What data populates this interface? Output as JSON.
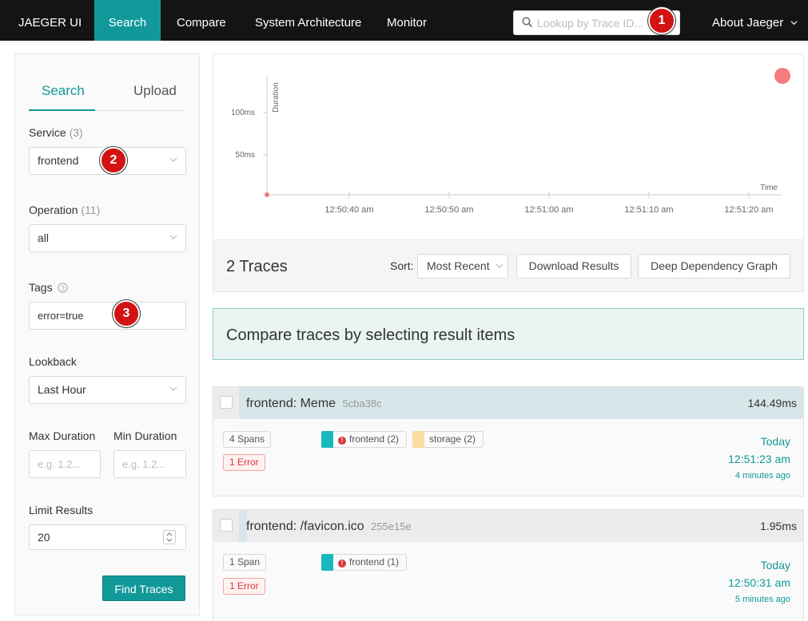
{
  "nav": {
    "brand": "JAEGER UI",
    "items": [
      "Search",
      "Compare",
      "System Architecture",
      "Monitor"
    ],
    "lookup_placeholder": "Lookup by Trace ID...",
    "about": "About Jaeger"
  },
  "badges": [
    "1",
    "2",
    "3"
  ],
  "form": {
    "tabs": [
      "Search",
      "Upload"
    ],
    "service_label": "Service",
    "service_count": "(3)",
    "service_value": "frontend",
    "operation_label": "Operation",
    "operation_count": "(11)",
    "operation_value": "all",
    "tags_label": "Tags",
    "tags_value": "error=true",
    "lookback_label": "Lookback",
    "lookback_value": "Last Hour",
    "max_duration_label": "Max Duration",
    "min_duration_label": "Min Duration",
    "max_duration_placeholder": "e.g. 1.2...",
    "min_duration_placeholder": "e.g. 1.2...",
    "limit_label": "Limit Results",
    "limit_value": "20",
    "find_button": "Find Traces"
  },
  "chart_data": {
    "type": "scatter",
    "ylabel": "Duration",
    "xlabel": "Time",
    "y_ticks": [
      "50ms",
      "100ms"
    ],
    "x_ticks": [
      "12:50:40 am",
      "12:50:50 am",
      "12:51:00 am",
      "12:51:10 am",
      "12:51:20 am"
    ]
  },
  "results": {
    "count_label": "2 Traces",
    "sort_label": "Sort:",
    "sort_value": "Most Recent",
    "download_button": "Download Results",
    "ddg_button": "Deep Dependency Graph",
    "compare_msg": "Compare traces by selecting result items"
  },
  "traces": [
    {
      "title": "frontend: Meme",
      "trace_id": "5cba38c",
      "duration": "144.49ms",
      "spans": "4 Spans",
      "errors": "1 Error",
      "services": [
        {
          "name": "frontend (2)",
          "color": "#17b8be",
          "error": true
        },
        {
          "name": "storage (2)",
          "color": "#f8dca1",
          "error": false
        }
      ],
      "date": "Today",
      "time": "12:51:23 am",
      "ago": "4 minutes ago"
    },
    {
      "title": "frontend: /favicon.ico",
      "trace_id": "255e15e",
      "duration": "1.95ms",
      "spans": "1 Span",
      "errors": "1 Error",
      "services": [
        {
          "name": "frontend (1)",
          "color": "#17b8be",
          "error": true
        }
      ],
      "date": "Today",
      "time": "12:50:31 am",
      "ago": "5 minutes ago"
    }
  ],
  "colors": {
    "accent": "#119999",
    "error": "#d9363e",
    "badge": "#d31212"
  }
}
